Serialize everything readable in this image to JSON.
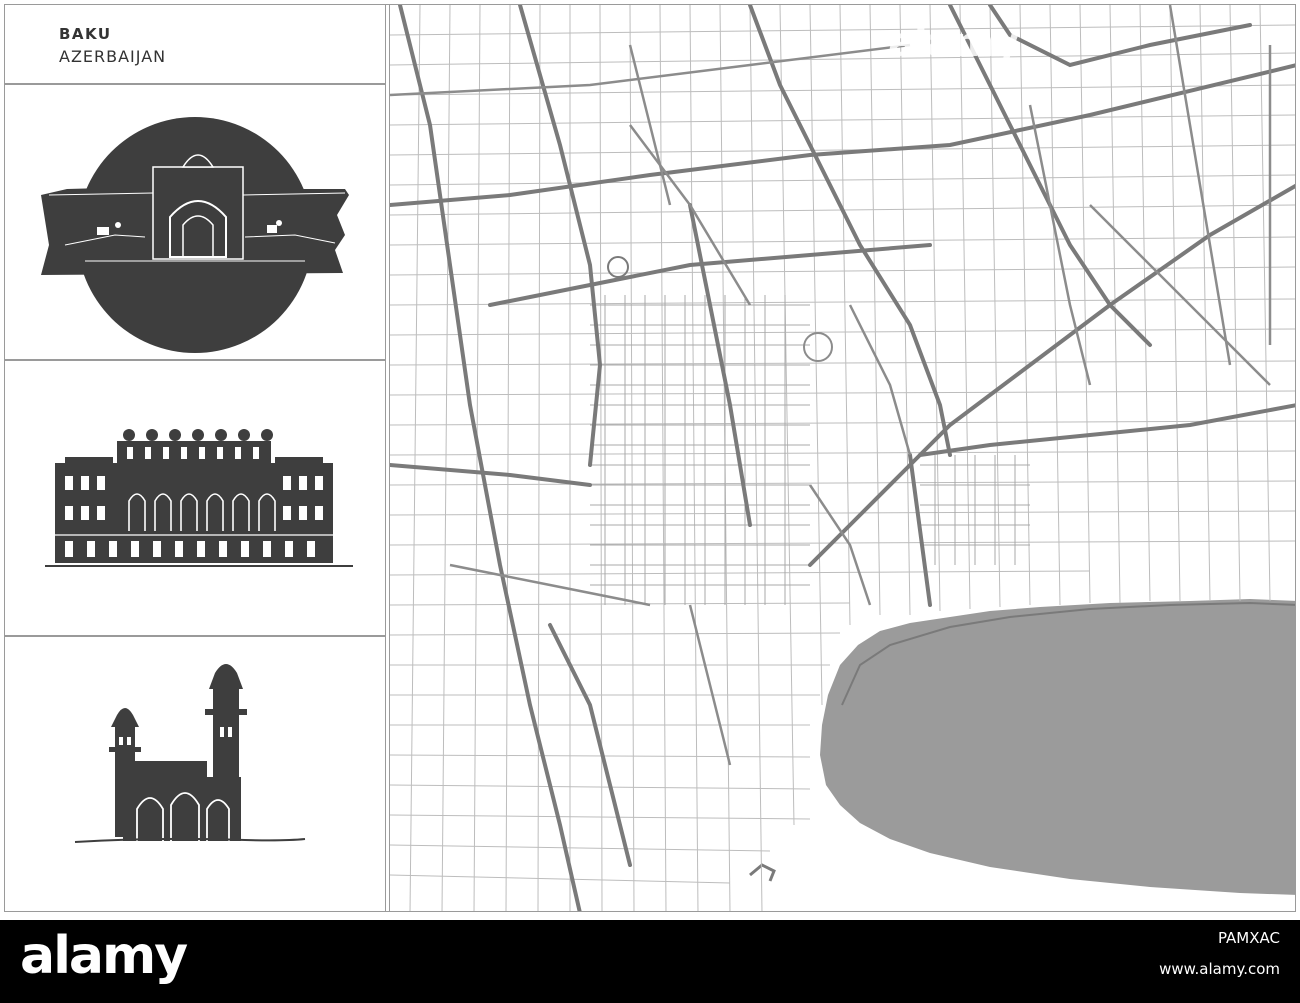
{
  "header": {
    "city": "BAKU",
    "country": "AZERBAIJAN"
  },
  "landmarks": [
    {
      "icon": "maiden-gate-icon"
    },
    {
      "icon": "museum-building-icon"
    },
    {
      "icon": "mosque-icon"
    }
  ],
  "map": {
    "water_color": "#9b9b9b",
    "road_color": "#7a7a7a",
    "watermark": "alamy"
  },
  "footer": {
    "logo": "alamy",
    "image_id": "PAMXAC",
    "url": "www.alamy.com"
  }
}
